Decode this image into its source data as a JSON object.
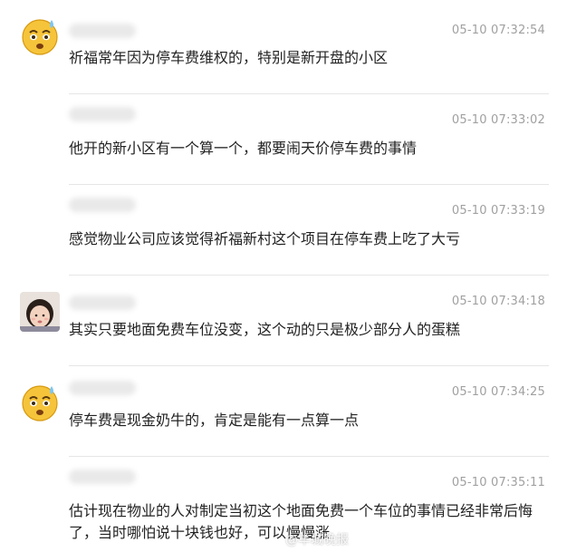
{
  "comments": [
    {
      "avatar": "cold-sweat-emoji-icon",
      "timestamp": "05-10 07:32:54",
      "text": "祈福常年因为停车费维权的，特别是新开盘的小区"
    },
    {
      "avatar": "",
      "timestamp": "05-10 07:33:02",
      "text": "他开的新小区有一个算一个，都要闹天价停车费的事情"
    },
    {
      "avatar": "",
      "timestamp": "05-10 07:33:19",
      "text": "感觉物业公司应该觉得祈福新村这个项目在停车费上吃了大亏"
    },
    {
      "avatar": "child-photo-avatar",
      "timestamp": "05-10 07:34:18",
      "text": "其实只要地面免费车位没变，这个动的只是极少部分人的蛋糕"
    },
    {
      "avatar": "cold-sweat-emoji-icon",
      "timestamp": "05-10 07:34:25",
      "text": "停车费是现金奶牛的，肯定是能有一点算一点"
    },
    {
      "avatar": "",
      "timestamp": "05-10 07:35:11",
      "text": "估计现在物业的人对制定当初这个地面免费一个车位的事情已经非常后悔了，当时哪怕说十块钱也好，可以慢慢涨"
    }
  ],
  "watermark": "@羊城晚报"
}
